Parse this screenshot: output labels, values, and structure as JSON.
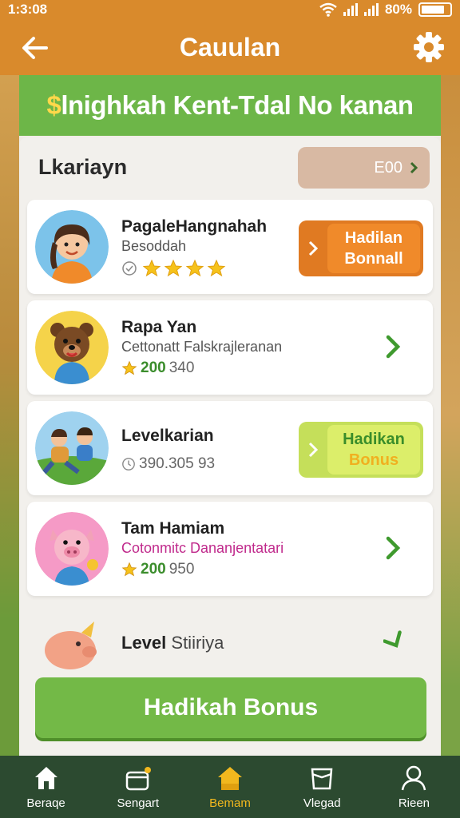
{
  "status_bar": {
    "time": "1:3:08",
    "battery": "80%"
  },
  "header": {
    "title": "Cauulan"
  },
  "banner": {
    "dollar": "$",
    "text": "lnighkah Kent-Tdal No kanan"
  },
  "section": {
    "title": "Lkariayn",
    "balance": "E00"
  },
  "cards": [
    {
      "title": "PagaleHangnahah",
      "subtitle": "Besoddah",
      "stars": 4,
      "button_line1": "Hadilan",
      "button_line2": "Bonnall"
    },
    {
      "title": "Rapa Yan",
      "subtitle": "Cettonatt Falskrajleranan",
      "meta_green": "200",
      "meta_grey": "340"
    },
    {
      "title": "Levelkarian",
      "meta_grey": "390.305 93",
      "button_line1": "Hadikan",
      "button_line2": "Bonus"
    },
    {
      "title": "Tam Hamiam",
      "subtitle": "Cotonmitc Dananjentatari",
      "meta_green": "200",
      "meta_grey": "950"
    }
  ],
  "level_row": {
    "bold": "Level",
    "light": "Stiiriya"
  },
  "primary_button": {
    "label": "Hadikah Bonus"
  },
  "bottom_nav": [
    {
      "label": "Beraqe",
      "icon": "home-icon"
    },
    {
      "label": "Sengart",
      "icon": "basket-icon"
    },
    {
      "label": "Bemam",
      "icon": "house-icon",
      "active": true
    },
    {
      "label": "Vlegad",
      "icon": "cup-icon"
    },
    {
      "label": "Rieen",
      "icon": "profile-icon"
    }
  ],
  "colors": {
    "header": "#d98a2c",
    "banner": "#6db648",
    "nav": "#2c4a30",
    "active_nav": "#f2b81e"
  }
}
